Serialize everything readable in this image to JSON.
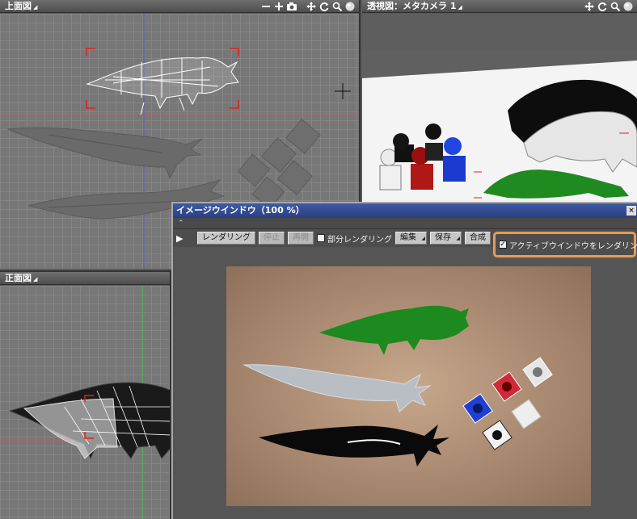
{
  "views": {
    "top": {
      "title": "上面図"
    },
    "front": {
      "title": "正面図"
    },
    "perspective": {
      "title": "透視図：メタカメラ 1"
    }
  },
  "image_window": {
    "title": "イメージウインドウ（100 %）",
    "close_label": "×",
    "toolbar": {
      "render_label": "レンダリング",
      "stop_label": "停止",
      "resume_label": "再開",
      "partial_render_label": "部分レンダリング",
      "partial_render_checked": false,
      "edit_label": "編集",
      "save_label": "保存",
      "composite_label": "合成",
      "active_window_render_label": "アクティブウインドウをレンダリング",
      "active_window_render_checked": true
    }
  },
  "colors": {
    "accent_highlight": "#e99a53",
    "selection_red": "#e02020",
    "title_blue": "#2b3f80"
  }
}
